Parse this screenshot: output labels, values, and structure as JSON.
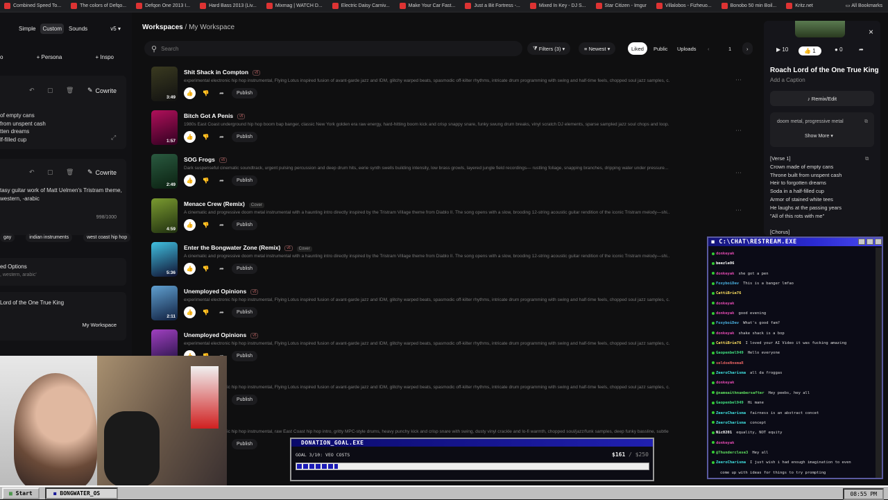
{
  "bookmarks": [
    "Combined Speed To...",
    "The colors of Defqo...",
    "Defqon One 2013 I...",
    "Hard Bass 2013 (Liv...",
    "Mixmag | WATCH D...",
    "Electric Daisy Carniv...",
    "Make Your Car Fast...",
    "Just a Bit Fortress -...",
    "Mixed In Key - DJ S...",
    "Star Citizen - Imgur",
    "Villalobos - Fizheuo...",
    "Bonobo 50 min Boil...",
    "Kritz.net"
  ],
  "all_bookmarks": "All Bookmarks",
  "left": {
    "modes": [
      "Simple",
      "Custom",
      "Sounds"
    ],
    "version": "v5",
    "row": [
      "o",
      "Persona",
      "Inspo"
    ],
    "cowrite": "Cowrite",
    "lyrics": [
      "of empty cans",
      "from unspent cash",
      "tten dreams",
      "lf-filled cup"
    ],
    "style_text": [
      "tasy guitar work of Matt Uelmen's Tristram theme,",
      "western, -arabic"
    ],
    "count": "998/1000",
    "tags": [
      "gay",
      "indian instruments",
      "west coast hip hop"
    ],
    "adv_title": "ed Options",
    "adv_sub": ", western, arabic'",
    "song_title": "Lord of the One True King",
    "ws": "My Workspace"
  },
  "crumb": {
    "root": "Workspaces",
    "sep": "/",
    "page": "My Workspace"
  },
  "search_placeholder": "Search",
  "controls": {
    "filters": "Filters (3)",
    "sort": "Newest",
    "liked": "Liked",
    "public": "Public",
    "uploads": "Uploads",
    "page": "1"
  },
  "songs": [
    {
      "title": "Shit Shack in Compton",
      "tag": "v5",
      "dur": "3:49",
      "desc": "experimental electronic hip hop instrumental, Flying Lotus inspired fusion of avant-garde jazz and IDM, glitchy warped beats, spasmodic off-kilter rhythms, intricate drum programming with swing and half-time feels, chopped soul jazz samples, c...",
      "c1": "#3a3a20",
      "c2": "#111"
    },
    {
      "title": "Bitch Got A Penis",
      "tag": "v5",
      "dur": "1:57",
      "desc": "1980s East Coast underground hip hop boom bap banger, classic New York golden era raw energy, hard-hitting boom kick and crisp snappy snare, funky swung drum breaks, vinyl scratch DJ elements, sparse sampled jazz soul chops and loop...",
      "c1": "#b0105a",
      "c2": "#300020"
    },
    {
      "title": "SOG Frogs",
      "tag": "v5",
      "dur": "2:49",
      "desc": "Dark suspenseful cinematic soundtrack, urgent pulsing percussion and deep drum hits, eerie synth swells building intensity, low brass growls, layered jungle field recordings— rustling foliage, snapping branches, dripping water under pressure...",
      "c1": "#2a5a40",
      "c2": "#0a2010"
    },
    {
      "title": "Menace Crew (Remix)",
      "tag": "",
      "cover": "Cover",
      "dur": "4:59",
      "desc": "A cinematic and progressive doom metal instrumental with a haunting intro directly inspired by the Tristram Village theme from Diablo II. The song opens with a slow, brooding 12-string acoustic guitar rendition of the iconic Tristram melody—shi...",
      "c1": "#7a9a30",
      "c2": "#203010"
    },
    {
      "title": "Enter the Bongwater Zone (Remix)",
      "tag": "v5",
      "cover": "Cover",
      "dur": "5:36",
      "desc": "A cinematic and progressive doom metal instrumental with a haunting intro directly inspired by the Tristram Village theme from Diablo II. The song opens with a slow, brooding 12-string acoustic guitar rendition of the iconic Tristram melody—shi...",
      "c1": "#40c0e0",
      "c2": "#101030"
    },
    {
      "title": "Unemployed Opinions",
      "tag": "v5",
      "dur": "2:11",
      "desc": "experimental electronic hip hop instrumental, Flying Lotus inspired fusion of avant-garde jazz and IDM, glitchy warped beats, spasmodic off-kilter rhythms, intricate drum programming with swing and half-time feels, chopped soul jazz samples, c...",
      "c1": "#60a0d0",
      "c2": "#102040"
    },
    {
      "title": "Unemployed Opinions",
      "tag": "v5",
      "dur": "",
      "desc": "experimental electronic hip hop instrumental, Flying Lotus inspired fusion of avant-garde jazz and IDM, glitchy warped beats, spasmodic off-kilter rhythms, intricate drum programming with swing and half-time feels, chopped soul jazz samples, c...",
      "c1": "#a040c0",
      "c2": "#201040"
    },
    {
      "title": "inions",
      "tag": "v5",
      "dur": "",
      "desc": "experimental electronic hip hop instrumental, Flying Lotus inspired fusion of avant-garde jazz and IDM, glitchy warped beats, spasmodic off-kilter rhythms, intricate drum programming with swing and half-time feels, chopped soul jazz samples, c...",
      "c1": "#333",
      "c2": "#111"
    },
    {
      "title": "inions",
      "tag": "v5",
      "dur": "",
      "desc": "experimental electronic hip hop instrumental, raw East Coast hip hop intro, gritty MPC-style drums, heavy punchy kick and crisp snare with swing, dusty vinyl crackle and lo-fi warmth, chopped soul/jazz/funk samples, deep funky bassline, subtle t...",
      "c1": "#333",
      "c2": "#111"
    }
  ],
  "publish": "Publish",
  "right": {
    "plays": "10",
    "likes": "1",
    "comments": "0",
    "title": "Roach Lord of the One True King",
    "caption": "Add a Caption",
    "remix": "Remix/Edit",
    "style": "doom metal, progressive metal",
    "show_more": "Show More",
    "lyrics": [
      "[Verse 1]",
      "Crown made of empty cans",
      "Throne built from unspent cash",
      "Heir to forgotten dreams",
      "Soda in a half-filled cup",
      "Armor of stained white tees",
      "He laughs at the passing years",
      "\"All of this rots with me\"",
      "",
      "[Chorus]"
    ]
  },
  "chat": {
    "title": "C:\\CHAT\\RESTREAM.EXE",
    "messages": [
      {
        "u": "donkeyak",
        "t": "",
        "c": "#e04ab0"
      },
      {
        "u": "beezle06",
        "t": "",
        "c": "#fff"
      },
      {
        "u": "donkeyak",
        "t": "she got a pen",
        "c": "#e04ab0"
      },
      {
        "u": "FoxyboiDev",
        "t": "This is a banger lmfao",
        "c": "#4ab0e0"
      },
      {
        "u": "CattiBrie76",
        "t": "",
        "c": "#ffe060"
      },
      {
        "u": "donkeyak",
        "t": "",
        "c": "#e04ab0"
      },
      {
        "u": "donkeyak",
        "t": "good evening",
        "c": "#e04ab0"
      },
      {
        "u": "FoxyboiDev",
        "t": "What's good fam?",
        "c": "#4ab0e0"
      },
      {
        "u": "donkeyak",
        "t": "shake shack is a bop",
        "c": "#e04ab0"
      },
      {
        "u": "CattiBrie76",
        "t": "I loved your AI Video it was fucking amazing",
        "c": "#ffe060"
      },
      {
        "u": "Gaopenbel949",
        "t": "Hello everyone",
        "c": "#40e080"
      },
      {
        "u": "seldoeNnemaR",
        "t": "",
        "c": "#e06060"
      },
      {
        "u": "ZeeroCharisma",
        "t": "all da froggas",
        "c": "#40e0e0"
      },
      {
        "u": "donkeyak",
        "t": "",
        "c": "#e04ab0"
      },
      {
        "u": "@nameaithnumbersafter",
        "t": "Hey peebs, hey all",
        "c": "#60e060"
      },
      {
        "u": "Gaopenbel949",
        "t": "Hi mane",
        "c": "#40e080"
      },
      {
        "u": "ZeeroCharisma",
        "t": "fairness is an abstract concet",
        "c": "#40e0e0"
      },
      {
        "u": "ZeeroCharisma",
        "t": "concept",
        "c": "#40e0e0"
      },
      {
        "u": "Nic0201",
        "t": "equality, NOT equity",
        "c": "#fff"
      },
      {
        "u": "donkeyak",
        "t": "",
        "c": "#e04ab0"
      },
      {
        "u": "@Thunderclese3",
        "t": "Hey all",
        "c": "#60e060"
      },
      {
        "u": "ZeeroCharisma",
        "t": "I just wish i had enough imagination to even",
        "c": "#40e0e0"
      },
      {
        "u": "",
        "t": "come up with ideas for things to try prompting",
        "c": "#fff"
      }
    ]
  },
  "donation": {
    "title": "DONATION_GOAL.EXE",
    "goal": "GOAL 3/10: VEO COSTS",
    "amount": "$161",
    "total": "/ $250",
    "progress": 0.644
  },
  "taskbar": {
    "start": "Start",
    "app": "BONGWATER_OS",
    "time": "08:55 PM"
  }
}
